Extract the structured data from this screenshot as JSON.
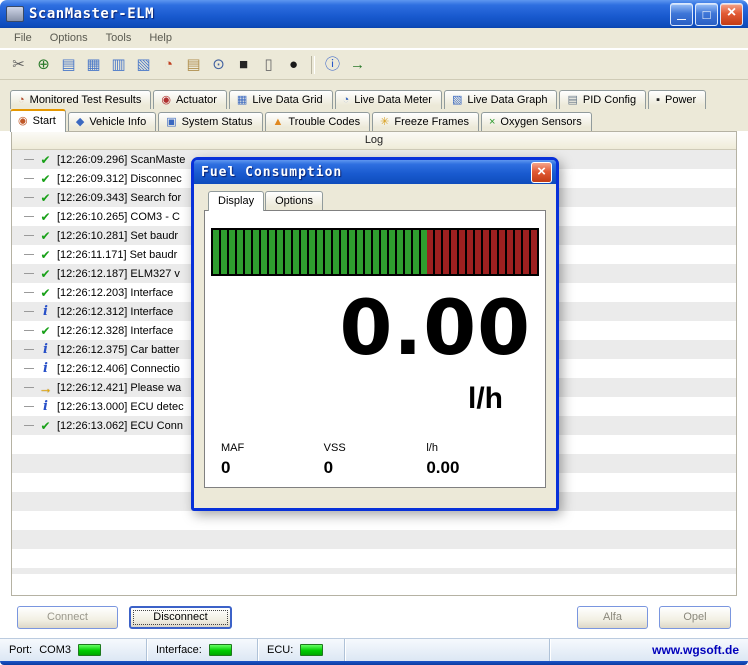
{
  "window": {
    "title": "ScanMaster-ELM"
  },
  "menu": {
    "items": [
      {
        "name": "menu-file",
        "label": "File"
      },
      {
        "name": "menu-options",
        "label": "Options"
      },
      {
        "name": "menu-tools",
        "label": "Tools"
      },
      {
        "name": "menu-help",
        "label": "Help"
      }
    ]
  },
  "toolbar": {
    "icons": [
      {
        "name": "interface-tools-icon",
        "glyph": "✂",
        "color": "#606060",
        "inter": "true"
      },
      {
        "name": "globe-icon",
        "glyph": "⊕",
        "color": "#2A7A2A",
        "inter": "true"
      },
      {
        "name": "report-icon",
        "glyph": "▤",
        "color": "#4A78C8",
        "inter": "true"
      },
      {
        "name": "data-grid-icon",
        "glyph": "▦",
        "color": "#4A78C8",
        "inter": "true"
      },
      {
        "name": "data-table-icon",
        "glyph": "▥",
        "color": "#4A78C8",
        "inter": "true"
      },
      {
        "name": "data-graph-icon",
        "glyph": "▧",
        "color": "#4A78C8",
        "inter": "true"
      },
      {
        "name": "gauge-icon",
        "glyph": "◔",
        "color": "#C04020",
        "inter": "true"
      },
      {
        "name": "notes-icon",
        "glyph": "▤",
        "color": "#B09050",
        "inter": "true"
      },
      {
        "name": "search-icon",
        "glyph": "⊙",
        "color": "#4060A0",
        "inter": "true"
      },
      {
        "name": "camera-icon",
        "glyph": "■",
        "color": "#252525",
        "inter": "true"
      },
      {
        "name": "battery-icon",
        "glyph": "▯",
        "color": "#6A6A6A",
        "inter": "true"
      },
      {
        "name": "disc-icon",
        "glyph": "●",
        "color": "#1A1A1A",
        "inter": "true"
      },
      {
        "name": "toolbar-separator",
        "type": "separator",
        "inter": "false"
      },
      {
        "name": "info-icon",
        "glyph": "ⓘ",
        "color": "#2858C8",
        "inter": "true"
      },
      {
        "name": "exit-icon",
        "glyph": "→",
        "color": "#2A7A2A",
        "inter": "true"
      }
    ]
  },
  "tabs_primary": [
    {
      "name": "tab-monitored-test-results",
      "label": "Monitored Test Results",
      "icon_name": "monitored-tests-icon",
      "icon_glyph": "◔",
      "icon_color": "#B24A2E"
    },
    {
      "name": "tab-actuator",
      "label": "Actuator",
      "icon_name": "actuator-icon",
      "icon_glyph": "◉",
      "icon_color": "#B03030"
    },
    {
      "name": "tab-live-data-grid",
      "label": "Live Data Grid",
      "icon_name": "live-data-grid-icon",
      "icon_glyph": "▦",
      "icon_color": "#3A68C0"
    },
    {
      "name": "tab-live-data-meter",
      "label": "Live Data Meter",
      "icon_name": "live-data-meter-icon",
      "icon_glyph": "◔",
      "icon_color": "#3A68C0"
    },
    {
      "name": "tab-live-data-graph",
      "label": "Live Data Graph",
      "icon_name": "live-data-graph-icon",
      "icon_glyph": "▧",
      "icon_color": "#3A68C0"
    },
    {
      "name": "tab-pid-config",
      "label": "PID Config",
      "icon_name": "pid-config-icon",
      "icon_glyph": "▤",
      "icon_color": "#6A7A8A"
    },
    {
      "name": "tab-power",
      "label": "Power",
      "icon_name": "power-icon",
      "icon_glyph": "▪",
      "icon_color": "#222222"
    }
  ],
  "tabs_secondary": [
    {
      "name": "tab-start",
      "label": "Start",
      "state": "active",
      "icon_name": "start-icon",
      "icon_glyph": "◉",
      "icon_color": "#C05828"
    },
    {
      "name": "tab-vehicle-info",
      "label": "Vehicle Info",
      "icon_name": "vehicle-info-icon",
      "icon_glyph": "◆",
      "icon_color": "#3A68C0"
    },
    {
      "name": "tab-system-status",
      "label": "System Status",
      "icon_name": "system-status-icon",
      "icon_glyph": "▣",
      "icon_color": "#3A68C0"
    },
    {
      "name": "tab-trouble-codes",
      "label": "Trouble Codes",
      "icon_name": "trouble-codes-icon",
      "icon_glyph": "▲",
      "icon_color": "#E08820"
    },
    {
      "name": "tab-freeze-frames",
      "label": "Freeze Frames",
      "icon_name": "freeze-frames-icon",
      "icon_glyph": "✳",
      "icon_color": "#D8A020"
    },
    {
      "name": "tab-oxygen-sensors",
      "label": "Oxygen Sensors",
      "icon_name": "oxygen-sensors-icon",
      "icon_glyph": "×",
      "icon_color": "#2A9A2A"
    }
  ],
  "log": {
    "header": "Log",
    "entries": [
      {
        "icon": "check-icon",
        "text": "[12:26:09.296] ScanMaste"
      },
      {
        "icon": "check-icon",
        "text": "[12:26:09.312] Disconnec"
      },
      {
        "icon": "check-icon",
        "text": "[12:26:09.343] Search for"
      },
      {
        "icon": "check-icon",
        "text": "[12:26:10.265] COM3 - C"
      },
      {
        "icon": "check-icon",
        "text": "[12:26:10.281] Set baudr"
      },
      {
        "icon": "check-icon",
        "text": "[12:26:11.171] Set baudr"
      },
      {
        "icon": "check-icon",
        "text": "[12:26:12.187] ELM327 v"
      },
      {
        "icon": "check-icon",
        "text": "[12:26:12.203] Interface"
      },
      {
        "icon": "info-icon",
        "text": "[12:26:12.312] Interface"
      },
      {
        "icon": "check-icon",
        "text": "[12:26:12.328] Interface"
      },
      {
        "icon": "info-icon",
        "text": "[12:26:12.375] Car batter"
      },
      {
        "icon": "info-icon",
        "text": "[12:26:12.406] Connectio"
      },
      {
        "icon": "arrow-icon",
        "text": "[12:26:12.421] Please wa"
      },
      {
        "icon": "info-icon",
        "text": "[12:26:13.000] ECU detec"
      },
      {
        "icon": "check-icon",
        "text": "[12:26:13.062] ECU Conn"
      }
    ]
  },
  "footer": {
    "connect": "Connect",
    "disconnect": "Disconnect",
    "alfa": "Alfa",
    "opel": "Opel"
  },
  "status": {
    "port_label": "Port:",
    "port_value": "COM3",
    "interface_label": "Interface:",
    "ecu_label": "ECU:",
    "website": "www.wgsoft.de"
  },
  "dialog": {
    "title": "Fuel Consumption",
    "tabs": [
      {
        "name": "dialog-tab-display",
        "label": "Display",
        "state": "active"
      },
      {
        "name": "dialog-tab-options",
        "label": "Options"
      }
    ],
    "value": "0.00",
    "unit": "l/h",
    "gauge": {
      "green_fraction": "66%",
      "green_segments": 27,
      "red_segments": 13,
      "green_color": "#2F9E2F",
      "red_color": "#9E2020",
      "background": "#000000"
    },
    "fields": [
      {
        "label": "MAF",
        "value": "0"
      },
      {
        "label": "VSS",
        "value": "0"
      },
      {
        "label": "l/h",
        "value": "0.00"
      }
    ]
  }
}
